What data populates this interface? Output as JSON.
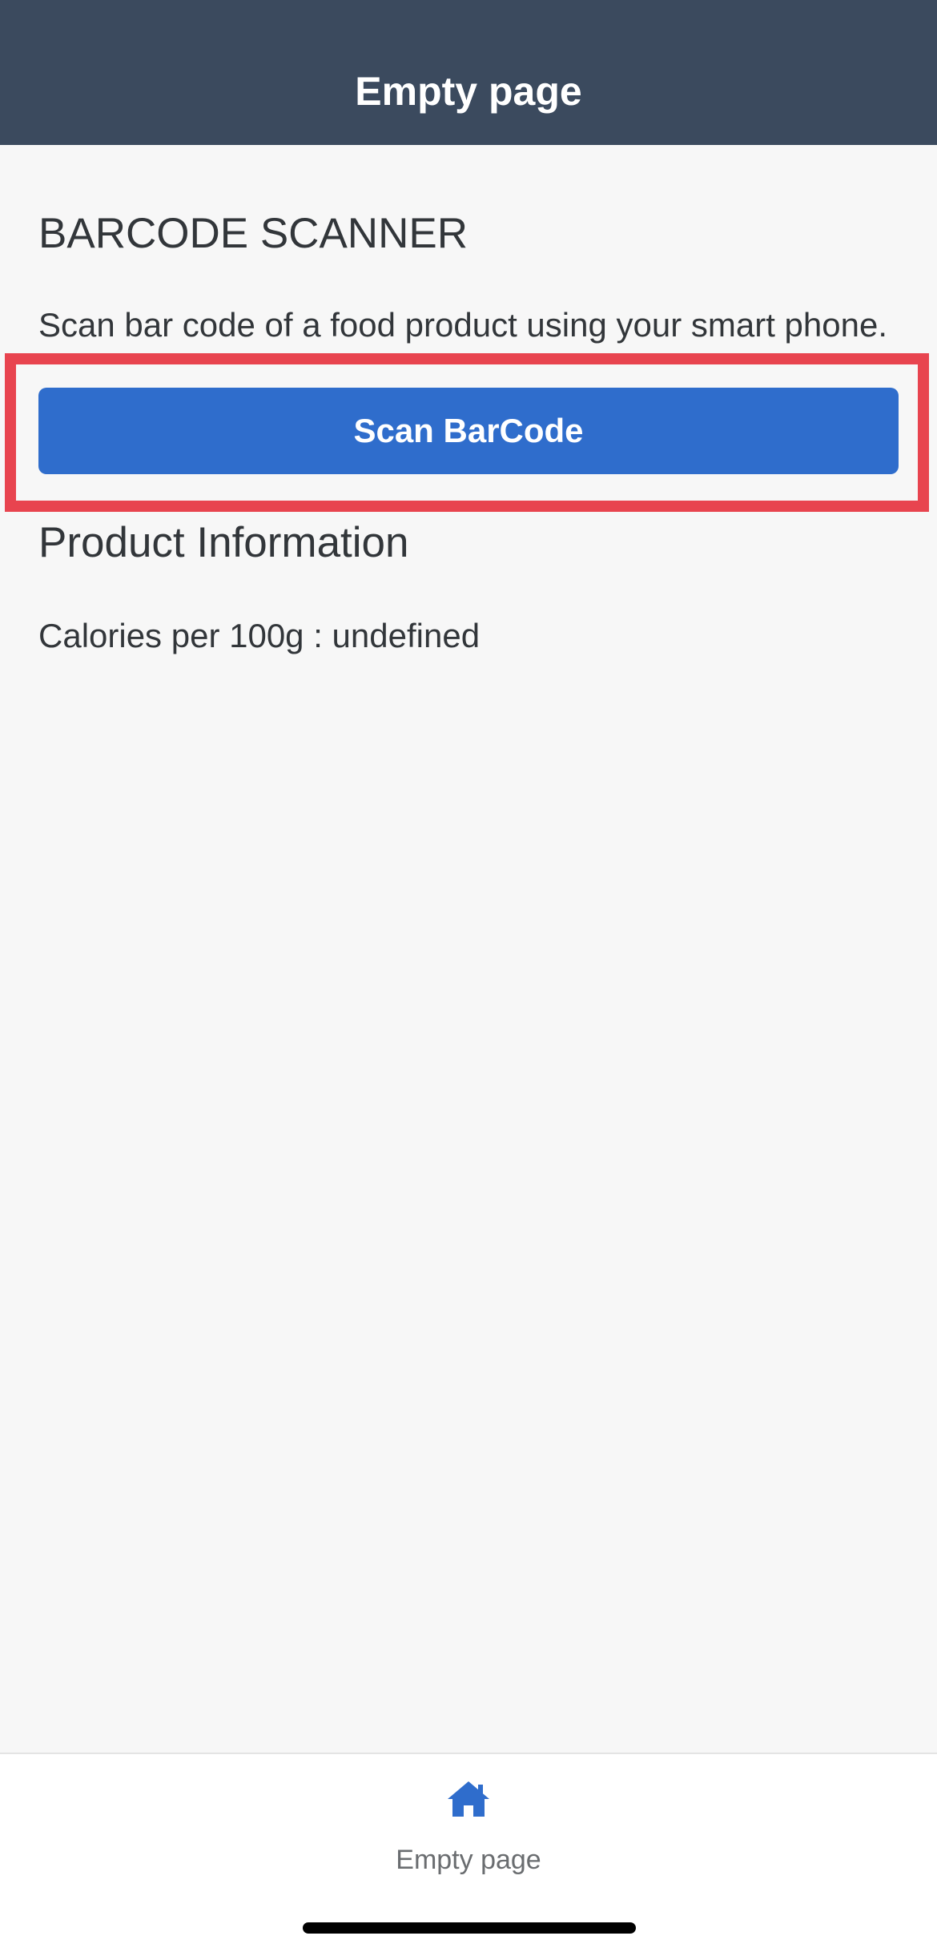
{
  "header": {
    "title": "Empty page"
  },
  "main": {
    "section_title": "BARCODE SCANNER",
    "description": "Scan bar code of a food product using your smart phone.",
    "scan_button_label": "Scan BarCode",
    "product_title": "Product Information",
    "calories_label": "Calories per 100g",
    "calories_separator": ":",
    "calories_value": "undefined"
  },
  "tabbar": {
    "items": [
      {
        "label": "Empty page",
        "icon": "home-icon",
        "active": true
      }
    ]
  },
  "colors": {
    "header_bg": "#3b4a5e",
    "accent": "#2f6dcc",
    "highlight": "#e8444f",
    "page_bg": "#f7f7f7"
  }
}
